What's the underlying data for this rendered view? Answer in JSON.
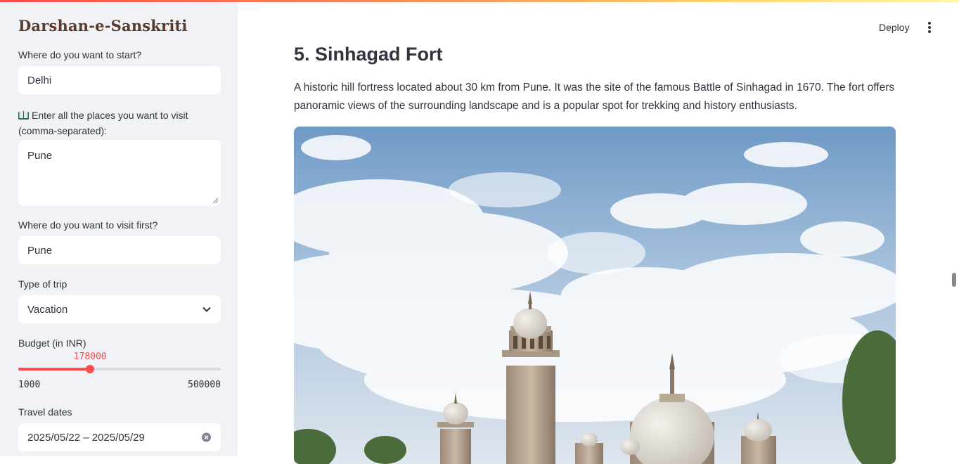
{
  "sidebar": {
    "app_title": "Darshan-e-Sanskriti",
    "start": {
      "label": "Where do you want to start?",
      "value": "Delhi"
    },
    "places": {
      "label": "Enter all the places you want to visit (comma-separated):",
      "icon": "book-icon",
      "value": "Pune"
    },
    "first": {
      "label": "Where do you want to visit first?",
      "value": "Pune"
    },
    "trip_type": {
      "label": "Type of trip",
      "selected": "Vacation"
    },
    "budget": {
      "label": "Budget (in INR)",
      "min_label": "1000",
      "max_label": "500000",
      "value_label": "178000",
      "min": 1000,
      "max": 500000,
      "value": 178000
    },
    "dates": {
      "label": "Travel dates",
      "value": "2025/05/22 – 2025/05/29"
    }
  },
  "header": {
    "deploy_label": "Deploy",
    "menu_icon": "more-vertical-icon"
  },
  "main": {
    "heading": "5. Sinhagad Fort",
    "paragraph": "A historic hill fortress located about 30 km from Pune. It was the site of the famous Battle of Sinhagad in 1670. The fort offers panoramic views of the surrounding landscape and is a popular spot for trekking and history enthusiasts."
  },
  "colors": {
    "accent": "#ff4b4b",
    "sidebar_bg": "#f0f2f6",
    "title": "#5a3a2a"
  }
}
